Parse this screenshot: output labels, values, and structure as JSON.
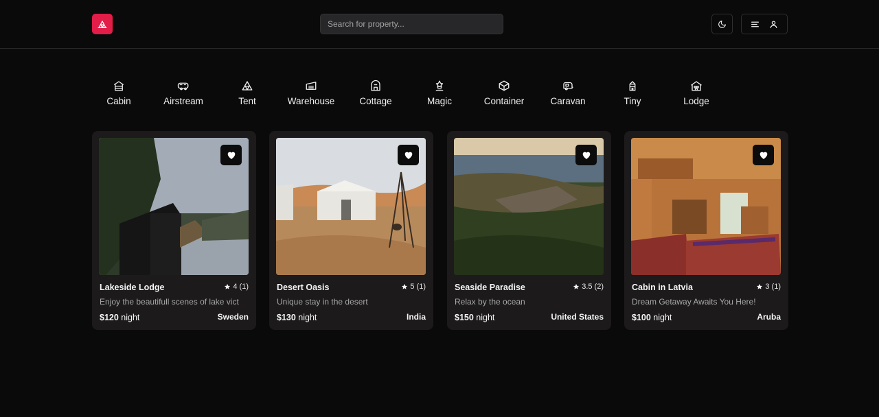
{
  "header": {
    "brand_color": "#e11d48",
    "logo_icon": "tent-icon",
    "search_placeholder": "Search for property...",
    "theme_icon": "moon-icon",
    "menu_icon": "hamburger-icon",
    "user_icon": "user-icon"
  },
  "categories": [
    {
      "label": "Cabin",
      "icon": "cabin-icon"
    },
    {
      "label": "Airstream",
      "icon": "airstream-icon"
    },
    {
      "label": "Tent",
      "icon": "tent-icon"
    },
    {
      "label": "Warehouse",
      "icon": "warehouse-icon"
    },
    {
      "label": "Cottage",
      "icon": "cottage-icon"
    },
    {
      "label": "Magic",
      "icon": "magic-icon"
    },
    {
      "label": "Container",
      "icon": "container-icon"
    },
    {
      "label": "Caravan",
      "icon": "caravan-icon"
    },
    {
      "label": "Tiny",
      "icon": "tiny-house-icon"
    },
    {
      "label": "Lodge",
      "icon": "lodge-icon"
    }
  ],
  "listings": [
    {
      "title": "Lakeside Lodge",
      "rating": "4 (1)",
      "description": "Enjoy the beautifull scenes of lake vict",
      "price": "$120",
      "price_unit": "night",
      "country": "Sweden"
    },
    {
      "title": "Desert Oasis",
      "rating": "5 (1)",
      "description": "Unique stay in the desert",
      "price": "$130",
      "price_unit": "night",
      "country": "India"
    },
    {
      "title": "Seaside Paradise",
      "rating": "3.5 (2)",
      "description": "Relax by the ocean",
      "price": "$150",
      "price_unit": "night",
      "country": "United States"
    },
    {
      "title": "Cabin in Latvia",
      "rating": "3 (1)",
      "description": "Dream Getaway Awaits You Here!",
      "price": "$100",
      "price_unit": "night",
      "country": "Aruba"
    }
  ]
}
